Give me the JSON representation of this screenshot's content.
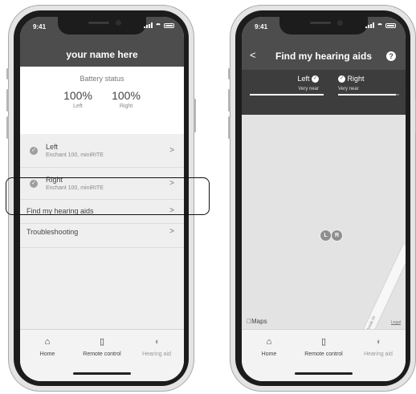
{
  "left_screen": {
    "status_time": "9:41",
    "header_title": "your name here",
    "battery": {
      "label": "Battery status",
      "left_pct": "100%",
      "left_label": "Left",
      "right_pct": "100%",
      "right_label": "Right"
    },
    "devices": [
      {
        "name": "Left",
        "model": "Enchant 100, miniRITE"
      },
      {
        "name": "Right",
        "model": "Enchant 100, miniRITE"
      }
    ],
    "menu": [
      "Find my hearing aids",
      "Troubleshooting"
    ],
    "chevron": ">",
    "tabs": [
      {
        "label": "Home",
        "icon": "home-icon",
        "active": true
      },
      {
        "label": "Remote control",
        "icon": "remote-icon",
        "active": true
      },
      {
        "label": "Hearing aid",
        "icon": "hearing-aid-icon",
        "active": false
      }
    ]
  },
  "right_screen": {
    "status_time": "9:41",
    "title": "Find my hearing aids",
    "back": "<",
    "help": "?",
    "left": {
      "label": "Left",
      "distance": "Very near",
      "signal": 1.0
    },
    "right": {
      "label": "Right",
      "distance": "Very near",
      "signal": 0.95
    },
    "pins": [
      "L",
      "R"
    ],
    "map_brand": "Maps",
    "legal": "Legal",
    "road_name": "Woods Dr",
    "tabs": [
      {
        "label": "Home",
        "icon": "home-icon",
        "active": true
      },
      {
        "label": "Remote control",
        "icon": "remote-icon",
        "active": true
      },
      {
        "label": "Hearing aid",
        "icon": "hearing-aid-icon",
        "active": false
      }
    ]
  },
  "colors": {
    "header": "#4d4d4d",
    "band": "#3d3d3d",
    "map": "#e3e3e3"
  }
}
